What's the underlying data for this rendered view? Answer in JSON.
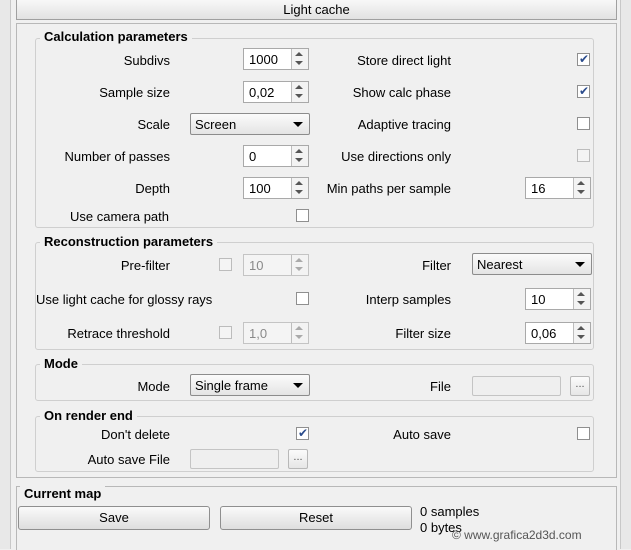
{
  "panel": {
    "title": "Light cache"
  },
  "calc": {
    "title": "Calculation parameters",
    "subdivs": {
      "label": "Subdivs",
      "value": "1000"
    },
    "sample_size": {
      "label": "Sample size",
      "value": "0,02"
    },
    "scale": {
      "label": "Scale",
      "value": "Screen"
    },
    "passes": {
      "label": "Number of passes",
      "value": "0"
    },
    "depth": {
      "label": "Depth",
      "value": "100"
    },
    "camera_path": {
      "label": "Use camera path",
      "checked": false
    },
    "store_direct": {
      "label": "Store direct light",
      "checked": true
    },
    "show_calc": {
      "label": "Show calc phase",
      "checked": true
    },
    "adaptive": {
      "label": "Adaptive tracing",
      "checked": false
    },
    "directions_only": {
      "label": "Use directions only",
      "checked": false
    },
    "min_paths": {
      "label": "Min paths per sample",
      "value": "16"
    }
  },
  "recon": {
    "title": "Reconstruction parameters",
    "prefilter": {
      "label": "Pre-filter",
      "checked": false,
      "value": "10"
    },
    "glossy": {
      "label": "Use light cache for glossy rays",
      "checked": false
    },
    "retrace": {
      "label": "Retrace threshold",
      "checked": false,
      "value": "1,0"
    },
    "filter": {
      "label": "Filter",
      "value": "Nearest"
    },
    "interp": {
      "label": "Interp samples",
      "value": "10"
    },
    "filter_size": {
      "label": "Filter size",
      "value": "0,06"
    }
  },
  "mode": {
    "title": "Mode",
    "mode": {
      "label": "Mode",
      "value": "Single frame"
    },
    "file": {
      "label": "File",
      "browse": "..."
    }
  },
  "render_end": {
    "title": "On render end",
    "dont_delete": {
      "label": "Don't delete",
      "checked": true
    },
    "auto_save": {
      "label": "Auto save",
      "checked": false
    },
    "auto_save_file": {
      "label": "Auto save File",
      "browse": "..."
    }
  },
  "current_map": {
    "title": "Current map",
    "save": "Save",
    "reset": "Reset",
    "samples": "0 samples",
    "bytes": "0 bytes"
  },
  "watermark": "© www.grafica2d3d.com",
  "colors": {
    "background": "#f0f0f0",
    "check": "#2b4c8c"
  }
}
